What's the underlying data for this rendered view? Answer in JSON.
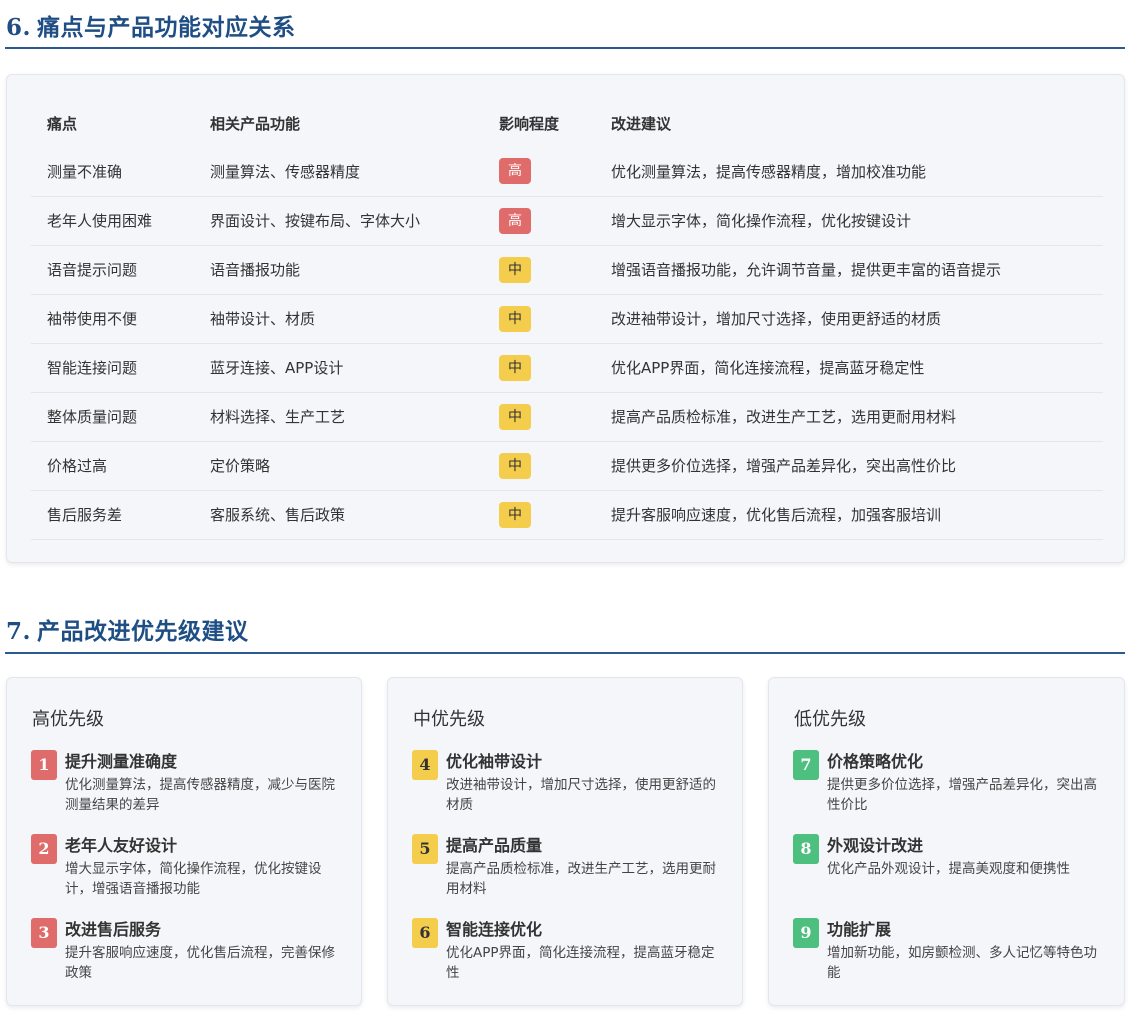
{
  "section6": {
    "number": "6.",
    "title": "痛点与产品功能对应关系",
    "headers": [
      "痛点",
      "相关产品功能",
      "影响程度",
      "改进建议"
    ],
    "rows": [
      {
        "pain": "测量不准确",
        "feature": "测量算法、传感器精度",
        "impact": "高",
        "suggestion": "优化测量算法，提高传感器精度，增加校准功能"
      },
      {
        "pain": "老年人使用困难",
        "feature": "界面设计、按键布局、字体大小",
        "impact": "高",
        "suggestion": "增大显示字体，简化操作流程，优化按键设计"
      },
      {
        "pain": "语音提示问题",
        "feature": "语音播报功能",
        "impact": "中",
        "suggestion": "增强语音播报功能，允许调节音量，提供更丰富的语音提示"
      },
      {
        "pain": "袖带使用不便",
        "feature": "袖带设计、材质",
        "impact": "中",
        "suggestion": "改进袖带设计，增加尺寸选择，使用更舒适的材质"
      },
      {
        "pain": "智能连接问题",
        "feature": "蓝牙连接、APP设计",
        "impact": "中",
        "suggestion": "优化APP界面，简化连接流程，提高蓝牙稳定性"
      },
      {
        "pain": "整体质量问题",
        "feature": "材料选择、生产工艺",
        "impact": "中",
        "suggestion": "提高产品质检标准，改进生产工艺，选用更耐用材料"
      },
      {
        "pain": "价格过高",
        "feature": "定价策略",
        "impact": "中",
        "suggestion": "提供更多价位选择，增强产品差异化，突出高性价比"
      },
      {
        "pain": "售后服务差",
        "feature": "客服系统、售后政策",
        "impact": "中",
        "suggestion": "提升客服响应速度，优化售后流程，加强客服培训"
      }
    ]
  },
  "section7": {
    "number": "7.",
    "title": "产品改进优先级建议",
    "cards": [
      {
        "heading": "高优先级",
        "items": [
          {
            "num": "1",
            "title": "提升测量准确度",
            "desc": "优化测量算法，提高传感器精度，减少与医院测量结果的差异"
          },
          {
            "num": "2",
            "title": "老年人友好设计",
            "desc": "增大显示字体，简化操作流程，优化按键设计，增强语音播报功能"
          },
          {
            "num": "3",
            "title": "改进售后服务",
            "desc": "提升客服响应速度，优化售后流程，完善保修政策"
          }
        ]
      },
      {
        "heading": "中优先级",
        "items": [
          {
            "num": "4",
            "title": "优化袖带设计",
            "desc": "改进袖带设计，增加尺寸选择，使用更舒适的材质"
          },
          {
            "num": "5",
            "title": "提高产品质量",
            "desc": "提高产品质检标准，改进生产工艺，选用更耐用材料"
          },
          {
            "num": "6",
            "title": "智能连接优化",
            "desc": "优化APP界面，简化连接流程，提高蓝牙稳定性"
          }
        ]
      },
      {
        "heading": "低优先级",
        "items": [
          {
            "num": "7",
            "title": "价格策略优化",
            "desc": "提供更多价位选择，增强产品差异化，突出高性价比"
          },
          {
            "num": "8",
            "title": "外观设计改进",
            "desc": "优化产品外观设计，提高美观度和便携性"
          },
          {
            "num": "9",
            "title": "功能扩展",
            "desc": "增加新功能，如房颤检测、多人记忆等特色功能"
          }
        ]
      }
    ]
  },
  "colors": {
    "title": "#1f4e85",
    "high": "#e06b6b",
    "mid": "#f5cd4d",
    "low": "#4dbf7f"
  }
}
